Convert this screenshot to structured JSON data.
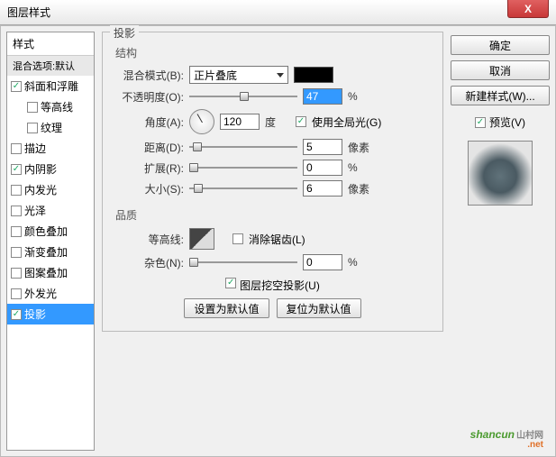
{
  "window": {
    "title": "图层样式",
    "close": "X"
  },
  "sidebar": {
    "header": "样式",
    "sub": "混合选项:默认",
    "items": [
      {
        "label": "斜面和浮雕",
        "checked": true,
        "indent": false
      },
      {
        "label": "等高线",
        "checked": false,
        "indent": true
      },
      {
        "label": "纹理",
        "checked": false,
        "indent": true
      },
      {
        "label": "描边",
        "checked": false,
        "indent": false
      },
      {
        "label": "内阴影",
        "checked": true,
        "indent": false
      },
      {
        "label": "内发光",
        "checked": false,
        "indent": false
      },
      {
        "label": "光泽",
        "checked": false,
        "indent": false
      },
      {
        "label": "颜色叠加",
        "checked": false,
        "indent": false
      },
      {
        "label": "渐变叠加",
        "checked": false,
        "indent": false
      },
      {
        "label": "图案叠加",
        "checked": false,
        "indent": false
      },
      {
        "label": "外发光",
        "checked": false,
        "indent": false
      },
      {
        "label": "投影",
        "checked": true,
        "indent": false,
        "selected": true
      }
    ]
  },
  "panel": {
    "title": "投影",
    "struct_title": "结构",
    "blend_label": "混合模式(B):",
    "blend_value": "正片叠底",
    "opacity_label": "不透明度(O):",
    "opacity_value": "47",
    "opacity_unit": "%",
    "angle_label": "角度(A):",
    "angle_value": "120",
    "angle_unit": "度",
    "global_label": "使用全局光(G)",
    "global_checked": true,
    "distance_label": "距离(D):",
    "distance_value": "5",
    "distance_unit": "像素",
    "spread_label": "扩展(R):",
    "spread_value": "0",
    "spread_unit": "%",
    "size_label": "大小(S):",
    "size_value": "6",
    "size_unit": "像素",
    "quality_title": "品质",
    "contour_label": "等高线:",
    "anti_label": "消除锯齿(L)",
    "anti_checked": false,
    "noise_label": "杂色(N):",
    "noise_value": "0",
    "noise_unit": "%",
    "knockout_label": "图层挖空投影(U)",
    "knockout_checked": true,
    "default_btn": "设置为默认值",
    "reset_btn": "复位为默认值"
  },
  "right": {
    "ok": "确定",
    "cancel": "取消",
    "newstyle": "新建样式(W)...",
    "preview": "预览(V)",
    "preview_checked": true
  },
  "watermark": {
    "brand": "shancun",
    "cn": "山村网",
    "net": ".net"
  }
}
